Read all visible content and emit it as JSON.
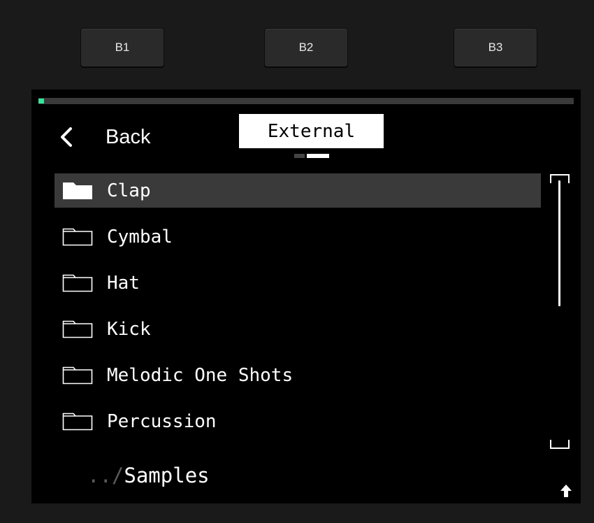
{
  "hardware_buttons": [
    {
      "label": "B1"
    },
    {
      "label": "B2"
    },
    {
      "label": "B3"
    }
  ],
  "screen": {
    "nav": {
      "back_label": "Back",
      "back_icon": "chevron-left-icon"
    },
    "title": "External",
    "page_indicator": {
      "count": 2,
      "active": 2
    },
    "progress_color": "#2ee89b",
    "folders": [
      {
        "name": "Clap",
        "selected": true,
        "icon": "folder-filled-icon"
      },
      {
        "name": "Cymbal",
        "selected": false,
        "icon": "folder-icon"
      },
      {
        "name": "Hat",
        "selected": false,
        "icon": "folder-icon"
      },
      {
        "name": "Kick",
        "selected": false,
        "icon": "folder-icon"
      },
      {
        "name": "Melodic One Shots",
        "selected": false,
        "icon": "folder-icon"
      },
      {
        "name": "Percussion",
        "selected": false,
        "icon": "folder-icon"
      }
    ],
    "path": {
      "prefix": "../",
      "name": "Samples"
    },
    "up_icon": "arrow-up-icon"
  }
}
